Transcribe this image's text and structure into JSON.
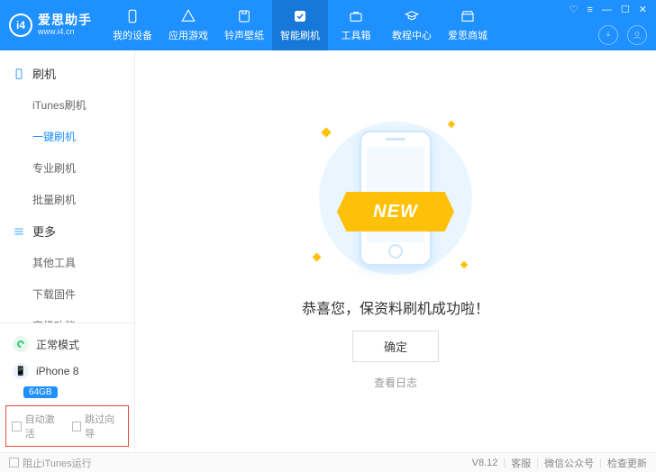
{
  "logo": {
    "badge": "i4",
    "title": "爱思助手",
    "subtitle": "www.i4.cn"
  },
  "topnav": [
    {
      "label": "我的设备"
    },
    {
      "label": "应用游戏"
    },
    {
      "label": "铃声壁纸"
    },
    {
      "label": "智能刷机"
    },
    {
      "label": "工具箱"
    },
    {
      "label": "教程中心"
    },
    {
      "label": "爱思商城"
    }
  ],
  "sidebar": {
    "group1": {
      "title": "刷机",
      "items": [
        "iTunes刷机",
        "一键刷机",
        "专业刷机",
        "批量刷机"
      ]
    },
    "group2": {
      "title": "更多",
      "items": [
        "其他工具",
        "下载固件",
        "高级功能"
      ]
    },
    "mode": "正常模式",
    "device": "iPhone 8",
    "storage": "64GB",
    "opt1": "自动激活",
    "opt2": "跳过向导"
  },
  "main": {
    "ribbon": "NEW",
    "message": "恭喜您，保资料刷机成功啦！",
    "ok": "确定",
    "log": "查看日志"
  },
  "status": {
    "block": "阻止iTunes运行",
    "version": "V8.12",
    "svc": "客服",
    "wx": "微信公众号",
    "upd": "检查更新"
  }
}
